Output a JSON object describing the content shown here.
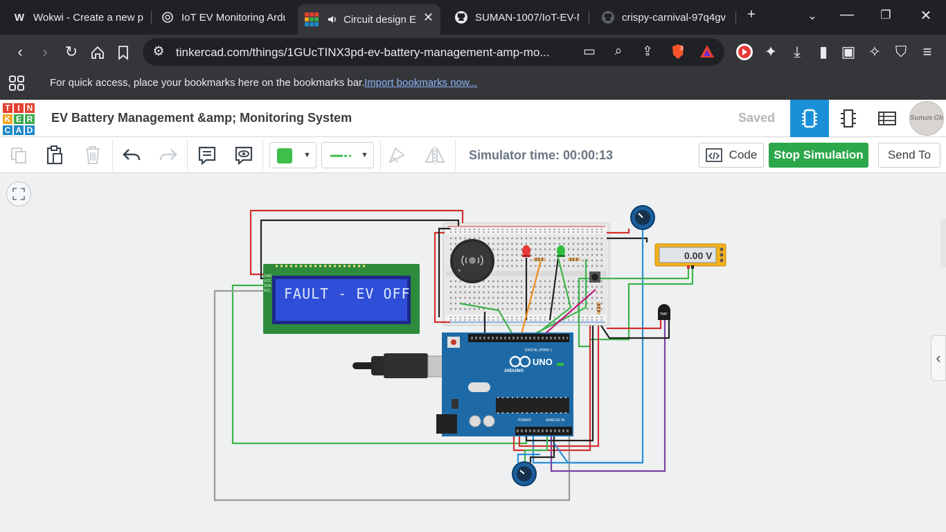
{
  "browser": {
    "tabs": [
      {
        "title": "Wokwi - Create a new p",
        "icon": "wokwi-icon"
      },
      {
        "title": "IoT EV Monitoring Ardu",
        "icon": "openai-icon"
      },
      {
        "title": "Circuit design E",
        "icon": "tinkercad-icon",
        "active": true
      },
      {
        "title": "SUMAN-1007/IoT-EV-M",
        "icon": "github-icon"
      },
      {
        "title": "crispy-carnival-97q4gv",
        "icon": "github-icon"
      }
    ],
    "new_tab": "+",
    "url": "tinkercad.com/things/1GUcTINX3pd-ev-battery-management-amp-mo...",
    "brave_badge": "3",
    "bookmarks_hint": "For quick access, place your bookmarks here on the bookmarks bar.",
    "bookmarks_link": "Import bookmarks now..."
  },
  "tinkercad": {
    "logo_letters": [
      "T",
      "I",
      "N",
      "K",
      "E",
      "R",
      "C",
      "A",
      "D"
    ],
    "project_title": "EV Battery Management &amp; Monitoring System",
    "saved_label": "Saved",
    "avatar_text": "Suman Gh"
  },
  "toolbar": {
    "simulator_time": "Simulator time: 00:00:13",
    "code_label": "Code",
    "stop_label": "Stop Simulation",
    "send_label": "Send To",
    "fill_color": "#3dbf4a"
  },
  "circuit": {
    "lcd_text": "FAULT - EV OFF",
    "multimeter_value": "0.00 V",
    "arduino_label": "UNO",
    "arduino_brand": "ARDUINO",
    "header_digital": "DIGITAL (PWM~)",
    "header_power": "POWER",
    "header_analog": "ANALOG IN",
    "sensor_label": "TMP",
    "colors": {
      "red": "#d32f2f",
      "black": "#222222",
      "green": "#3cb44b",
      "blue": "#2b8fd6",
      "orange": "#f08a1c",
      "purple": "#7b3fa0",
      "magenta": "#c2187a",
      "gray": "#9a9a9a",
      "arduino": "#1e6aa6",
      "lcd_screen": "#2f4fd8",
      "lcd_board": "#2e8b3c"
    }
  }
}
